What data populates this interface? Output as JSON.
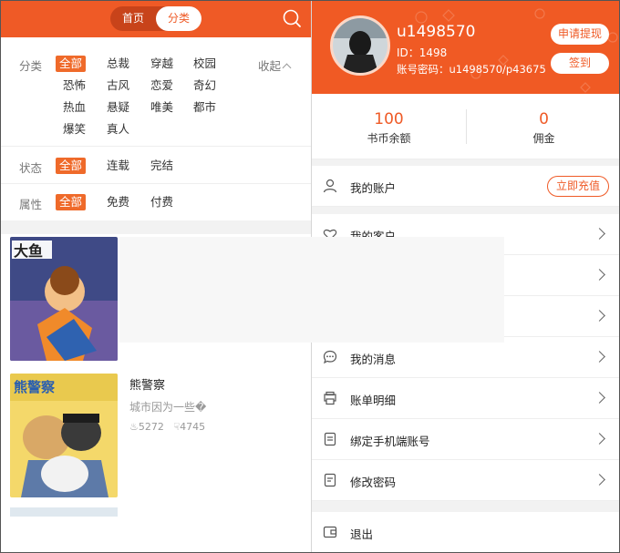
{
  "left": {
    "nav": {
      "home": "首页",
      "category": "分类"
    },
    "filters": {
      "category_label": "分类",
      "category_tags": [
        "全部",
        "总裁",
        "穿越",
        "校园",
        "恐怖",
        "古风",
        "恋爱",
        "奇幻",
        "热血",
        "悬疑",
        "唯美",
        "都市",
        "爆笑",
        "真人"
      ],
      "collapse_label": "收起",
      "status_label": "状态",
      "status_tags": [
        "全部",
        "连载",
        "完结"
      ],
      "attr_label": "属性",
      "attr_tags": [
        "全部",
        "免费",
        "付费"
      ]
    },
    "books": [
      {
        "title": "",
        "desc": "",
        "views": "",
        "likes": ""
      },
      {
        "title": "熊警察",
        "desc": "城市因为一些�",
        "views": "5272",
        "likes": "4745"
      }
    ]
  },
  "right": {
    "user": {
      "name": "u1498570",
      "id": "ID：1498",
      "account": "账号密码：u1498570/p43675"
    },
    "buttons": {
      "withdraw": "申请提现",
      "signin": "签到"
    },
    "wallet": [
      {
        "value": "100",
        "label": "书币余额"
      },
      {
        "value": "0",
        "label": "佣金"
      }
    ],
    "account_item": {
      "label": "我的账户",
      "action": "立即充值"
    },
    "menu": [
      {
        "label": "我的客户",
        "icon": "heart-icon"
      },
      {
        "label": "",
        "icon": ""
      },
      {
        "label": "",
        "icon": ""
      },
      {
        "label": "我的消息",
        "icon": "chat-icon"
      },
      {
        "label": "账单明细",
        "icon": "bill-icon"
      },
      {
        "label": "绑定手机端账号",
        "icon": "phone-bind-icon"
      },
      {
        "label": "修改密码",
        "icon": "lock-doc-icon"
      }
    ],
    "logout": "退出"
  },
  "colors": {
    "accent": "#ef5a26",
    "background": "#f2f2f2"
  }
}
